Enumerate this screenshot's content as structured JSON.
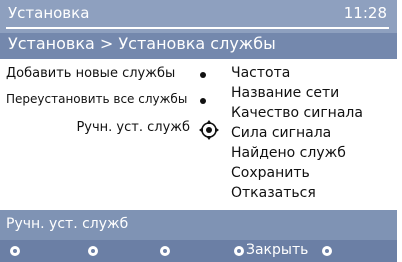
{
  "window": {
    "title": "Установка",
    "time": "11:28"
  },
  "breadcrumb": "Установка > Установка службы",
  "left_menu": {
    "items": [
      {
        "label": "Добавить новые службы"
      },
      {
        "label": "Переустановить все службы"
      },
      {
        "label": "Ручн. уст. служб"
      }
    ]
  },
  "right_menu": {
    "items": [
      "Частота",
      "Название сети",
      "Качество сигнала",
      "Сила сигнала",
      "Найдено служб",
      "Сохранить",
      "Отказаться"
    ]
  },
  "status": {
    "text": "Ручн. уст. служб"
  },
  "bottom_bar": {
    "close_label": "Закрыть"
  },
  "colors": {
    "background": "#7f93b4",
    "panel": "#ffffff",
    "text_light": "#ffffff",
    "text_dark": "#111111"
  },
  "icons": [
    "radio-dot-icon",
    "navigation-pad-icon",
    "color-key-icon"
  ]
}
